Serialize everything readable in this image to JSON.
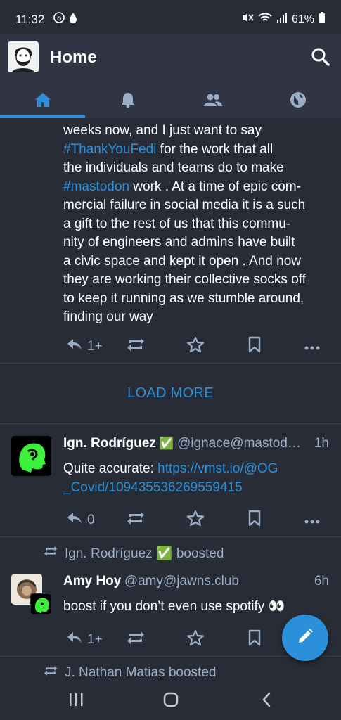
{
  "status_bar": {
    "time": "11:32",
    "battery": "61%"
  },
  "app_bar": {
    "title": "Home"
  },
  "tabs": [
    "home",
    "notifications",
    "local",
    "federated"
  ],
  "posts": [
    {
      "body_lines": [
        [
          "weeks now, and I just want to say"
        ],
        [
          {
            "tag": "#ThankYouFedi"
          },
          "  for the work that all"
        ],
        [
          "the individuals and teams do to make"
        ],
        [
          {
            "tag": "#mastodon"
          },
          " work . At a time of epic com-"
        ],
        [
          "mercial failure in social media it is a such"
        ],
        [
          "a gift to the rest of us that this commu-"
        ],
        [
          "nity of engineers and admins have built"
        ],
        [
          "a civic space and kept it open . And now"
        ],
        [
          "they are working their collective socks off"
        ],
        [
          "to keep it running as we stumble around,"
        ],
        [
          "finding our way"
        ]
      ],
      "reply_count": "1+"
    }
  ],
  "load_more": "LOAD MORE",
  "post2": {
    "name": "Ign. Rodríguez",
    "verified": "✅",
    "handle": "@ignace@mastod…",
    "time": "1h",
    "text": "Quite accurate: ",
    "link_line1": "https://vmst.io/@OG",
    "link_line2": "_Covid/109435536269559415",
    "reply_count": "0"
  },
  "post3": {
    "boosted_by": "Ign. Rodríguez ✅ boosted",
    "name": "Amy Hoy",
    "handle": "@amy@jawns.club",
    "time": "6h",
    "text": "boost if you don’t even use spotify 👀",
    "reply_count": "1+"
  },
  "post4": {
    "boosted_by": "J. Nathan Matias boosted"
  },
  "colors": {
    "accent": "#2b90d9",
    "muted": "#9baec8",
    "bg": "#282c37",
    "bar": "#313543"
  }
}
